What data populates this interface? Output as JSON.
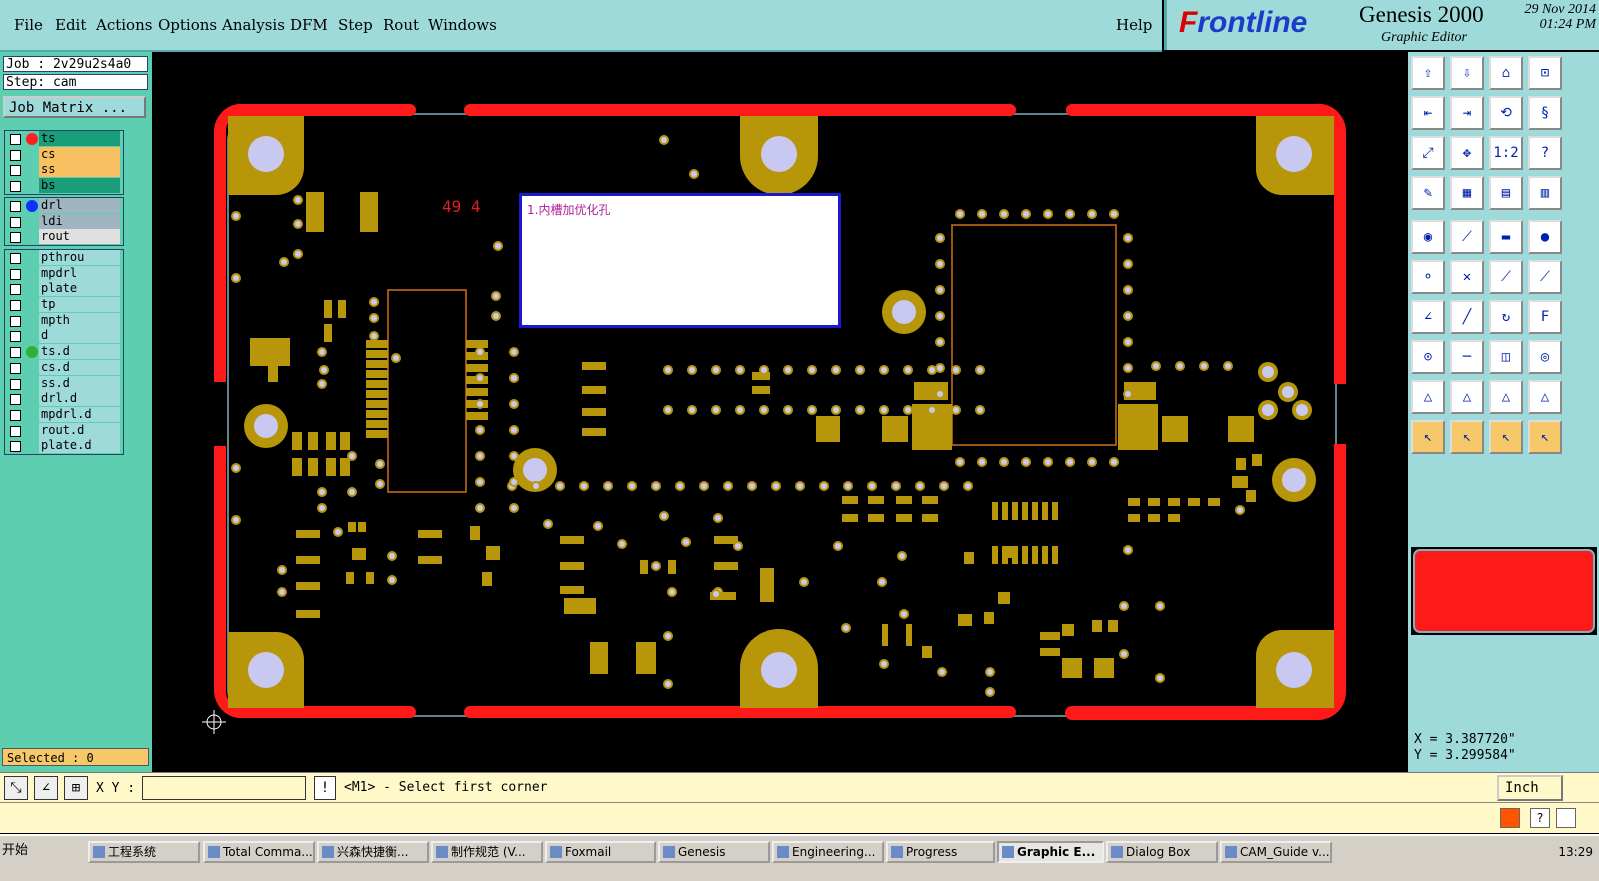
{
  "menu": {
    "items": [
      "File",
      "Edit",
      "Actions",
      "Options",
      "Analysis",
      "DFM",
      "Step",
      "Rout",
      "Windows"
    ],
    "help": "Help"
  },
  "brand": {
    "logo_prefix": "F",
    "logo_rest": "rontline",
    "product": "Genesis 2000",
    "subtitle": "Graphic Editor",
    "date": "29 Nov 2014",
    "time": "01:24 PM"
  },
  "job": {
    "job_line": "Job : 2v29u2s4a0",
    "step_line": "Step: cam",
    "matrix_button": "Job Matrix ..."
  },
  "layers": {
    "group1": [
      {
        "name": "ts",
        "color": "#1a9e7a",
        "dot": "#ff2020"
      },
      {
        "name": "cs",
        "color": "#f7c060",
        "dot": ""
      },
      {
        "name": "ss",
        "color": "#f7c060",
        "dot": ""
      },
      {
        "name": "bs",
        "color": "#1a9e7a",
        "dot": ""
      }
    ],
    "group2": [
      {
        "name": "drl",
        "color": "#9fb6c0",
        "dot": "#1030ff"
      },
      {
        "name": "ldi",
        "color": "#9fb6c0",
        "dot": ""
      },
      {
        "name": "rout",
        "color": "#e0e0e0",
        "dot": ""
      }
    ],
    "group3": [
      {
        "name": "pthrou",
        "color": "#9fdada",
        "dot": ""
      },
      {
        "name": "mpdrl",
        "color": "#9fdada",
        "dot": ""
      },
      {
        "name": "plate",
        "color": "#9fdada",
        "dot": ""
      },
      {
        "name": "tp",
        "color": "#9fdada",
        "dot": ""
      },
      {
        "name": "mpth",
        "color": "#9fdada",
        "dot": ""
      },
      {
        "name": "d",
        "color": "#9fdada",
        "dot": ""
      },
      {
        "name": "ts.d",
        "color": "#9fdada",
        "dot": "#30b030"
      },
      {
        "name": "cs.d",
        "color": "#9fdada",
        "dot": ""
      },
      {
        "name": "ss.d",
        "color": "#9fdada",
        "dot": ""
      },
      {
        "name": "drl.d",
        "color": "#9fdada",
        "dot": ""
      },
      {
        "name": "mpdrl.d",
        "color": "#9fdada",
        "dot": ""
      },
      {
        "name": "rout.d",
        "color": "#9fdada",
        "dot": ""
      },
      {
        "name": "plate.d",
        "color": "#9fdada",
        "dot": ""
      }
    ]
  },
  "selected": "Selected : 0",
  "board": {
    "note_text": "1.内槽加优化孔",
    "marker_text": "49 4"
  },
  "coords": {
    "x": "X = 3.387720\"",
    "y": "Y = 3.299584\""
  },
  "command": {
    "xy_label": "X Y :",
    "xy_value": "",
    "exclaim": "!",
    "prompt": "<M1> - Select first corner",
    "unit": "Inch"
  },
  "taskbar": {
    "start": "开始",
    "tasks": [
      {
        "label": "工程系统",
        "active": false
      },
      {
        "label": "Total Comma...",
        "active": false
      },
      {
        "label": "兴森快捷衡...",
        "active": false
      },
      {
        "label": "制作规范 (V...",
        "active": false
      },
      {
        "label": "Foxmail",
        "active": false
      },
      {
        "label": "Genesis",
        "active": false
      },
      {
        "label": "Engineering...",
        "active": false
      },
      {
        "label": "Progress",
        "active": false
      },
      {
        "label": "Graphic E...",
        "active": true
      },
      {
        "label": "Dialog Box",
        "active": false
      },
      {
        "label": "CAM_Guide v...",
        "active": false
      }
    ],
    "clock": "13:29"
  },
  "colors": {
    "menu_bg": "#9fdada",
    "panel_bg": "#5dcfb0",
    "copper": "#b8960a",
    "outline_red": "#ff1a1a",
    "hole": "#c8c8f0"
  }
}
